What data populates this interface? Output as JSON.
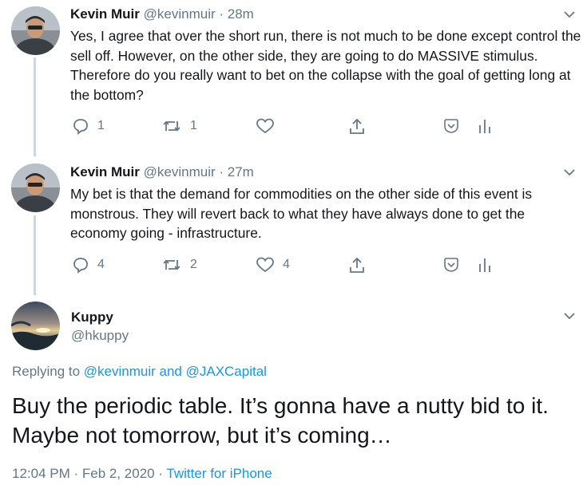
{
  "tweets": [
    {
      "name": "Kevin Muir",
      "meta": "@kevinmuir · 28m",
      "text": "Yes, I agree that over the short run, there is not much to be done except control the sell off.  However, on the other side, they are going to do MASSIVE stimulus.  Therefore do you really want to bet on the collapse with the goal of getting long at the bottom?",
      "reply_count": "1",
      "retweet_count": "1",
      "like_count": ""
    },
    {
      "name": "Kevin Muir",
      "meta": "@kevinmuir · 27m",
      "text": "My bet is that the demand for commodities on the other side of this event is monstrous.  They will revert back to what they have always done to get the economy going - infrastructure.",
      "reply_count": "4",
      "retweet_count": "2",
      "like_count": "4"
    }
  ],
  "main_tweet": {
    "name": "Kuppy",
    "handle": "@hkuppy",
    "replying_prefix": "Replying to ",
    "replying_user1": "@kevinmuir",
    "replying_and": " and ",
    "replying_user2": "@JAXCapital",
    "text": "Buy the periodic table. It’s gonna have a nutty bid to it. Maybe not tomorrow, but it’s coming…",
    "time": "12:04 PM · Feb 2, 2020 · ",
    "source": "Twitter for iPhone"
  },
  "colors": {
    "link": "#1b95e0",
    "secondary": "#657786",
    "thread_line": "#ccd6dd"
  },
  "icons": [
    "chevron-down-icon",
    "reply-icon",
    "retweet-icon",
    "like-icon",
    "share-icon",
    "save-icon",
    "analytics-icon"
  ]
}
